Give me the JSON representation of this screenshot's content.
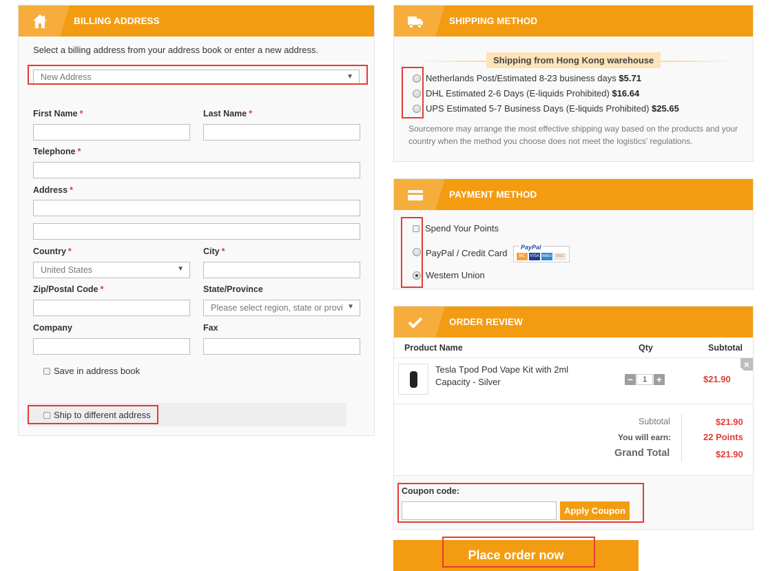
{
  "billing": {
    "title": "BILLING ADDRESS",
    "intro": "Select a billing address from your address book or enter a new address.",
    "address_select": "New Address",
    "first_name_label": "First Name",
    "last_name_label": "Last Name",
    "telephone_label": "Telephone",
    "address_label": "Address",
    "country_label": "Country",
    "country_value": "United States",
    "city_label": "City",
    "zip_label": "Zip/Postal Code",
    "state_label": "State/Province",
    "state_placeholder": "Please select region, state or provi",
    "company_label": "Company",
    "fax_label": "Fax",
    "required_mark": "*",
    "save_label": "Save in address book",
    "ship_diff_label": "Ship to different address"
  },
  "shipping": {
    "title": "SHIPPING METHOD",
    "warehouse": "Shipping from Hong Kong warehouse",
    "options": [
      {
        "label": "Netherlands Post/Estimated 8-23 business days",
        "price": "$5.71"
      },
      {
        "label": "DHL Estimated 2-6 Days (E-liquids Prohibited)",
        "price": "$16.64"
      },
      {
        "label": "UPS Estimated 5-7 Business Days (E-liquids Prohibited)",
        "price": "$25.65"
      }
    ],
    "note_line1": "Sourcemore may arrange the most effective shipping way based on the products and your",
    "note_line2": "country when the method you choose does not meet the logistics' regulations."
  },
  "payment": {
    "title": "PAYMENT METHOD",
    "options": [
      "Spend Your Points",
      "PayPal / Credit Card",
      "Western Union"
    ],
    "selected": "Western Union",
    "paypal_logo": "PayPal",
    "card_logos": [
      "MC",
      "VISA",
      "AMEX",
      "DISC"
    ]
  },
  "review": {
    "title": "ORDER REVIEW",
    "col_product": "Product Name",
    "col_qty": "Qty",
    "col_subtotal": "Subtotal",
    "item_name_line1": "Tesla Tpod Pod Vape Kit with 2ml",
    "item_name_line2": "Capacity - Silver",
    "item_qty": "1",
    "item_price": "$21.90",
    "minus": "−",
    "plus": "+",
    "remove": "×",
    "subtotal_label": "Subtotal",
    "subtotal_value": "$21.90",
    "earn_label": "You will earn:",
    "earn_value": "22 Points",
    "grand_label": "Grand Total",
    "grand_value": "$21.90",
    "coupon_label": "Coupon code:",
    "coupon_value": "",
    "apply_label": "Apply Coupon",
    "place_order": "Place order now"
  },
  "colors": {
    "accent": "#f39c12",
    "highlight": "#e53935",
    "price": "#e53935"
  }
}
